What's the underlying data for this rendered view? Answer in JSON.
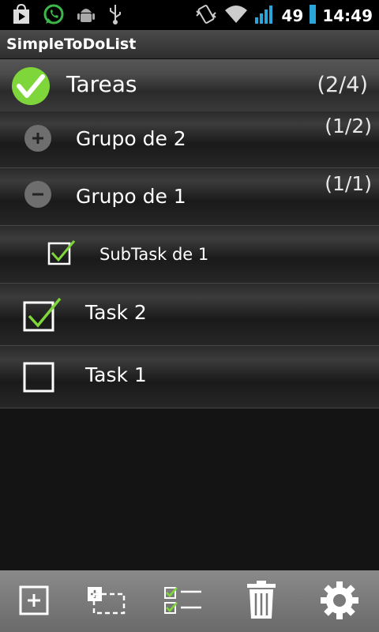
{
  "status_bar": {
    "battery": "49",
    "time": "14:49"
  },
  "app": {
    "title": "SimpleToDoList"
  },
  "list": {
    "header": {
      "label": "Tareas",
      "count": "(2/4)",
      "icon": "check-circle-icon"
    },
    "groups": [
      {
        "label": "Grupo de 2",
        "count": "(1/2)",
        "expanded": false,
        "icon": "expand-plus-icon"
      },
      {
        "label": "Grupo de 1",
        "count": "(1/1)",
        "expanded": true,
        "icon": "collapse-minus-icon"
      }
    ],
    "subtasks": [
      {
        "label": "SubTask de 1",
        "checked": true
      }
    ],
    "tasks": [
      {
        "label": "Task 2",
        "checked": true
      },
      {
        "label": "Task 1",
        "checked": false
      }
    ]
  },
  "toolbar": {
    "buttons": [
      {
        "name": "add-task-button",
        "icon": "plus-box-icon"
      },
      {
        "name": "add-group-button",
        "icon": "add-group-icon"
      },
      {
        "name": "check-list-button",
        "icon": "checklist-icon"
      },
      {
        "name": "delete-button",
        "icon": "trash-icon"
      },
      {
        "name": "settings-button",
        "icon": "gear-icon"
      }
    ]
  },
  "colors": {
    "check_green": "#7fd63a",
    "accent_blue": "#2aa5d8",
    "whatsapp_green": "#3cb84b"
  }
}
